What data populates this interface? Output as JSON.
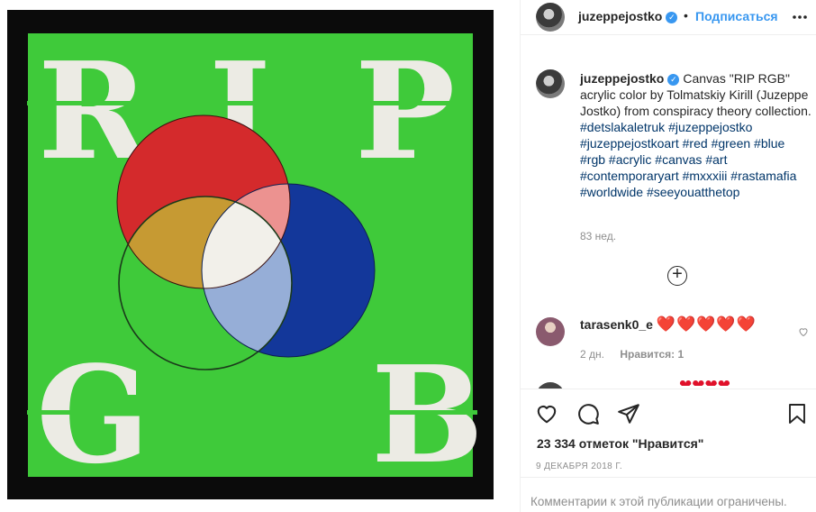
{
  "header": {
    "username": "juzeppejostko",
    "separator": "•",
    "follow_label": "Подписаться",
    "more_label": "•••"
  },
  "artwork": {
    "letters": [
      "R",
      "I",
      "P",
      "G",
      "B"
    ],
    "colors": {
      "frame": "#0b0b0b",
      "canvas": "#3fca3a",
      "letters": "#ecebe4",
      "red": "#d42a2c",
      "blue": "#13379a",
      "pink": "#ec9290",
      "ochre": "#c69a33",
      "lightblue": "#96aed7",
      "white": "#f2f0ea",
      "outline": "#1b3a1b"
    }
  },
  "caption": {
    "username": "juzeppejostko",
    "text": "Canvas \"RIP RGB\" acrylic color by Tolmatskiy Kirill (Juzeppe Jostko) from conspiracy theory collection.",
    "hashtags": [
      "#detslakaletruk",
      "#juzeppejostko",
      "#juzeppejostkoart",
      "#red",
      "#green",
      "#blue",
      "#rgb",
      "#acrylic",
      "#canvas",
      "#art",
      "#contemporaryart",
      "#mxxxiii",
      "#rastamafia",
      "#worldwide",
      "#seeyouatthetop"
    ],
    "time_ago": "83 нед."
  },
  "load_more_label": "+",
  "comment": {
    "username": "tarasenk0_e",
    "text": "❤️❤️❤️❤️❤️",
    "time": "2 дн.",
    "likes": "Нравится: 1"
  },
  "icons": {
    "like": "heart-icon",
    "comment": "comment-bubble-icon",
    "share": "paper-plane-icon",
    "save": "bookmark-icon",
    "load_more": "plus-circle-icon"
  },
  "likes_count": "23 334 отметок \"Нравится\"",
  "post_date": "9 ДЕКАБРЯ 2018 Г.",
  "comments_disabled": "Комментарии к этой публикации ограничены."
}
